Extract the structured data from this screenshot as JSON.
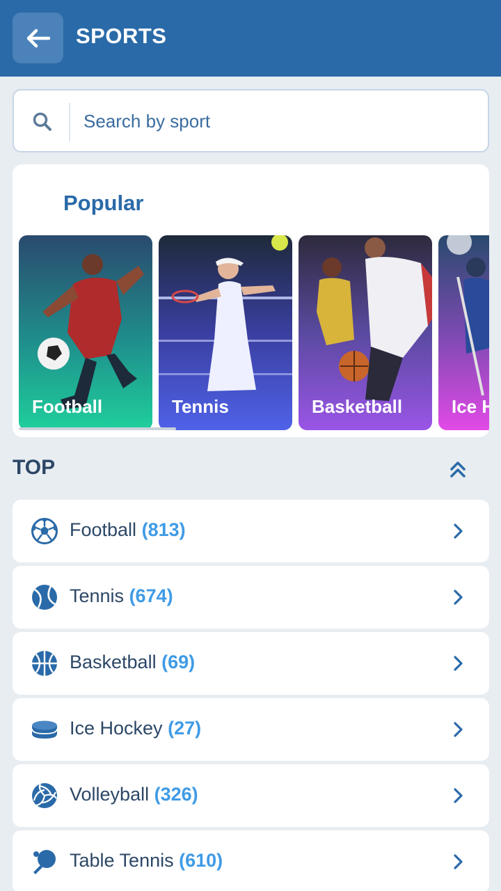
{
  "header": {
    "title": "SPORTS",
    "back_icon": "arrow-left-icon"
  },
  "search": {
    "placeholder": "Search by sport",
    "icon": "search-icon"
  },
  "popular": {
    "title": "Popular",
    "cards": [
      {
        "label": "Football"
      },
      {
        "label": "Tennis"
      },
      {
        "label": "Basketball"
      },
      {
        "label": "Ice H"
      }
    ]
  },
  "top": {
    "title": "TOP",
    "collapse_icon": "double-chevron-up-icon",
    "items": [
      {
        "name": "Football",
        "count": "(813)",
        "icon": "football-icon"
      },
      {
        "name": "Tennis",
        "count": "(674)",
        "icon": "tennis-ball-icon"
      },
      {
        "name": "Basketball",
        "count": "(69)",
        "icon": "basketball-icon"
      },
      {
        "name": "Ice Hockey",
        "count": "(27)",
        "icon": "hockey-puck-icon"
      },
      {
        "name": "Volleyball",
        "count": "(326)",
        "icon": "volleyball-icon"
      },
      {
        "name": "Table Tennis",
        "count": "(610)",
        "icon": "table-tennis-icon"
      }
    ]
  },
  "colors": {
    "header": "#2a6aa8",
    "accent": "#3f9be6",
    "background": "#e8edf2"
  }
}
